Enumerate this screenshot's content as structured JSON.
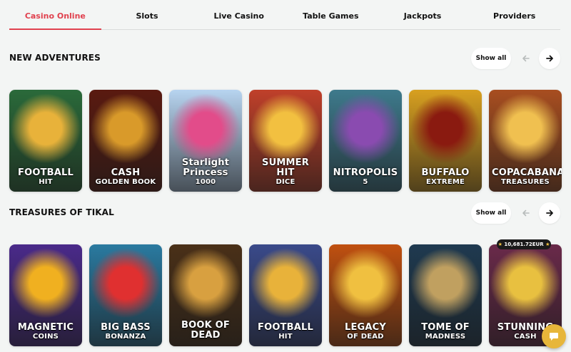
{
  "tabs": [
    {
      "label": "Casino Online",
      "active": true
    },
    {
      "label": "Slots"
    },
    {
      "label": "Live Casino"
    },
    {
      "label": "Table Games"
    },
    {
      "label": "Jackpots"
    },
    {
      "label": "Providers"
    }
  ],
  "sections": [
    {
      "title": "NEW ADVENTURES",
      "show_all": "Show all",
      "games": [
        {
          "title": "FOOTBALL",
          "subtitle": "HIT",
          "bg": "#2a6a3a",
          "accent": "#e8b23a"
        },
        {
          "title": "CASH",
          "subtitle": "GOLDEN BOOK",
          "bg": "#5a1a10",
          "accent": "#d99a2a"
        },
        {
          "title": "Starlight Princess",
          "subtitle": "1000",
          "bg": "#b7d4f0",
          "accent": "#e24c8a"
        },
        {
          "title": "SUMMER HIT",
          "subtitle": "DICE",
          "bg": "#c0402a",
          "accent": "#f2c040"
        },
        {
          "title": "NITROPOLIS",
          "subtitle": "5",
          "bg": "#3e7a8c",
          "accent": "#8a4bb0"
        },
        {
          "title": "BUFFALO",
          "subtitle": "EXTREME",
          "bg": "#d8a020",
          "accent": "#8a1a10"
        },
        {
          "title": "COPACABANA",
          "subtitle": "TREASURES",
          "bg": "#a84e20",
          "accent": "#f0c050"
        }
      ]
    },
    {
      "title": "TREASURES OF TIKAL",
      "show_all": "Show all",
      "games": [
        {
          "title": "MAGNETIC",
          "subtitle": "COINS",
          "bg": "#4a2a8a",
          "accent": "#f0b020"
        },
        {
          "title": "BIG BASS",
          "subtitle": "BONANZA",
          "bg": "#2a7aa0",
          "accent": "#e03030"
        },
        {
          "title": "BOOK OF DEAD",
          "subtitle": "",
          "bg": "#4a3018",
          "accent": "#d8a040"
        },
        {
          "title": "FOOTBALL",
          "subtitle": "HIT",
          "bg": "#3a4a8a",
          "accent": "#e8b23a"
        },
        {
          "title": "LEGACY",
          "subtitle": "OF DEAD",
          "bg": "#c05010",
          "accent": "#f0c040"
        },
        {
          "title": "TOME OF",
          "subtitle": "MADNESS",
          "bg": "#1f3a50",
          "accent": "#c0a060"
        },
        {
          "title": "STUNNING",
          "subtitle": "CASH",
          "bg": "#6a2a4a",
          "accent": "#e8c040"
        }
      ]
    }
  ],
  "jackpot_badge": "10,681.72EUR",
  "icons": {
    "prev": "arrow-left-icon",
    "next": "arrow-right-icon",
    "chat": "chat-icon"
  }
}
